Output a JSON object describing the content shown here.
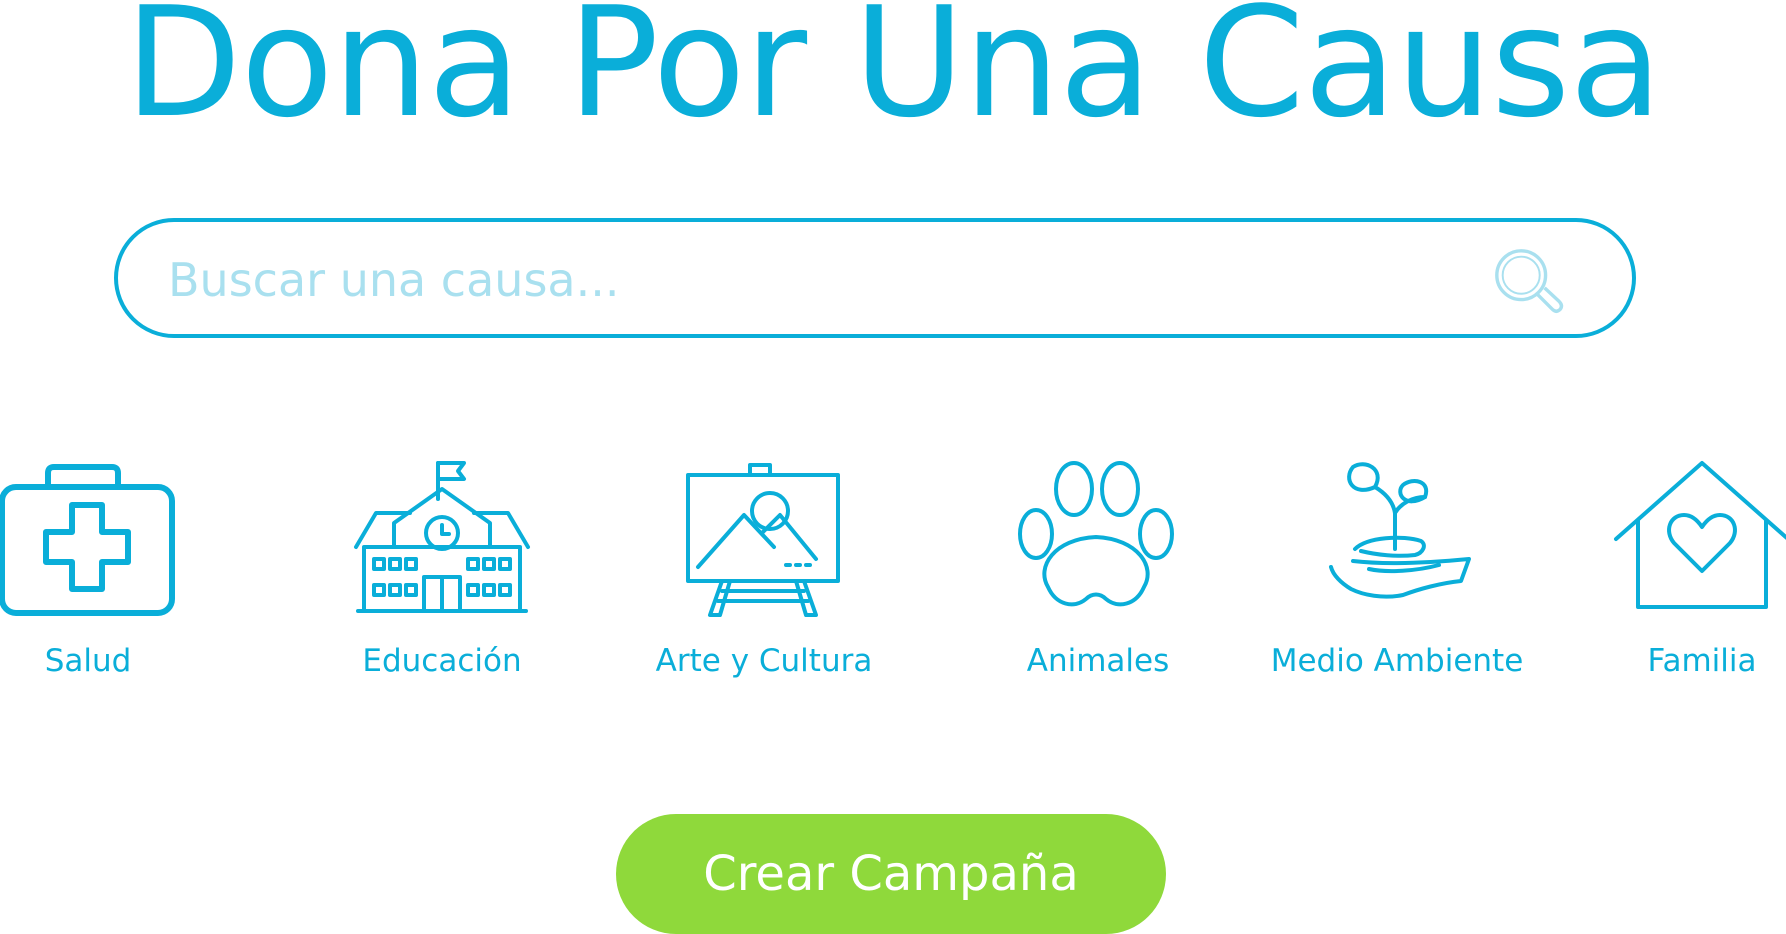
{
  "header": {
    "title": "Dona Por Una Causa"
  },
  "search": {
    "placeholder": "Buscar una causa...",
    "value": "",
    "icon": "search-icon"
  },
  "categories": [
    {
      "label": "Salud",
      "icon": "first-aid-kit-icon"
    },
    {
      "label": "Educación",
      "icon": "school-icon"
    },
    {
      "label": "Arte y Cultura",
      "icon": "easel-icon"
    },
    {
      "label": "Animales",
      "icon": "paw-icon"
    },
    {
      "label": "Medio Ambiente",
      "icon": "plant-in-hand-icon"
    },
    {
      "label": "Familia",
      "icon": "house-heart-icon"
    }
  ],
  "cta": {
    "label": "Crear Campaña"
  },
  "colors": {
    "primary": "#0aaed9",
    "primary_light": "#a9e0ef",
    "accent": "#8fd93b",
    "background": "#ffffff"
  }
}
